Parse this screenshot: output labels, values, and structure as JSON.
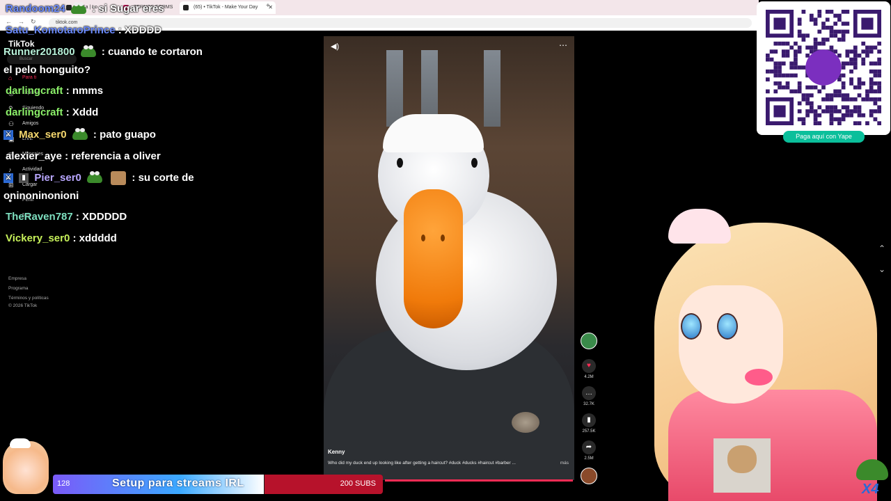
{
  "browser": {
    "tabs": [
      {
        "label": "TuSa | Lo"
      },
      {
        "label": "TERNOS FORMS"
      },
      {
        "label": "(65) • TikTok - Make Your Day"
      }
    ],
    "url": "tiktok.com"
  },
  "tiktok": {
    "logo": "TikTok",
    "search_placeholder": "Buscar",
    "nav": [
      {
        "label": "Para ti"
      },
      {
        "label": "Explorar"
      },
      {
        "label": "Siguiendo"
      },
      {
        "label": "Amigos"
      },
      {
        "label": "LIVE"
      },
      {
        "label": "Mensajes"
      },
      {
        "label": "Actividad"
      },
      {
        "label": "Cargar"
      },
      {
        "label": "Perfil"
      },
      {
        "label": "Más"
      }
    ],
    "footer": [
      "Empresa",
      "Programa",
      "Términos y políticas",
      "© 2026 TikTok"
    ]
  },
  "chat": [
    {
      "user": "Randoom24",
      "color": "#6c8cff",
      "text": ": si Sugar eres"
    },
    {
      "user": "Satu_KomotaroPrince",
      "color": "#6c8cff",
      "text": ": XDDDD"
    },
    {
      "user": "Runner201800",
      "color": "#b7f0d8",
      "text": ": cuando te cortaron el pelo honguito?"
    },
    {
      "user": "darlingcraft",
      "color": "#8cf06a",
      "text": ": nmms"
    },
    {
      "user": "darlingcraft",
      "color": "#8cf06a",
      "text": ": Xddd"
    },
    {
      "user": "Max_ser0",
      "color": "#f5d76e",
      "text": ": pato guapo"
    },
    {
      "user": "alexier_aye",
      "color": "#ffffff",
      "text": ": referencia a oliver"
    },
    {
      "user": "Pier_ser0",
      "color": "#b9a7ff",
      "text": ": su corte de oninoninonioni"
    },
    {
      "user": "TheRaven787",
      "color": "#7ee0c0",
      "text": ": XDDDDD"
    },
    {
      "user": "Vickery_ser0",
      "color": "#c6f05a",
      "text": ": xddddd"
    }
  ],
  "video": {
    "author": "Kenny",
    "caption": "Who did my duck end up looking like after getting a haircut? #duck #ducks #haircut #barber ...",
    "more": "más",
    "likes": "4.2M",
    "comments": "32.7K",
    "saves": "257.5K",
    "shares": "2.5M"
  },
  "goal": {
    "count": "128",
    "title": "Setup para streams IRL",
    "target": "200 SUBS",
    "progress": 0.64
  },
  "yape": {
    "label": "Paga aquí con Yape"
  },
  "overlay": {
    "multiplier": "X4"
  }
}
